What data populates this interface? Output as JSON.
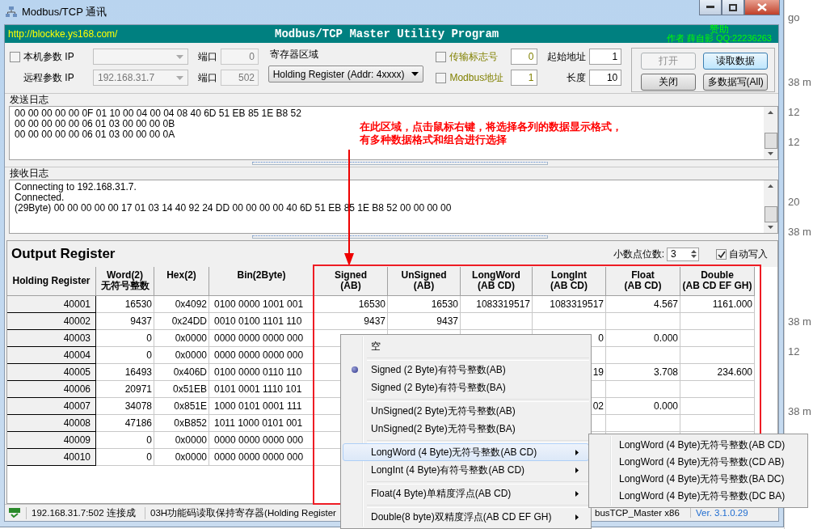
{
  "window": {
    "title": "Modbus/TCP 通讯"
  },
  "banner": {
    "link": "http://blockke.ys168.com/",
    "title": "Modbus/TCP Master Utility Program",
    "sponsor": "赞助",
    "author": "作者 薛自影 QQ:22236263"
  },
  "local": {
    "label": "本机参数 IP",
    "checked": false,
    "port_label": "端口",
    "port": "0"
  },
  "remote": {
    "label": "远程参数 IP",
    "ip": "192.168.31.7",
    "port_label": "端口",
    "port": "502"
  },
  "register_area": {
    "label": "寄存器区域",
    "value": "Holding Register (Addr: 4xxxx)"
  },
  "options": [
    {
      "label": "传输标志号",
      "checked": false,
      "value": "0"
    },
    {
      "label": "Modbus地址",
      "checked": false,
      "value": "1"
    }
  ],
  "address": [
    {
      "label": "起始地址",
      "value": "1"
    },
    {
      "label": "长度",
      "value": "10"
    }
  ],
  "buttons": [
    {
      "label": "打开",
      "disabled": true
    },
    {
      "label": "读取数据",
      "disabled": false
    },
    {
      "label": "关闭",
      "disabled": false
    },
    {
      "label": "多数据写(All)",
      "disabled": false
    }
  ],
  "send_log": {
    "title": "发送日志",
    "lines": [
      "00 00 00 00 00 0F 01 10 00 04 00 04 08 40 6D 51 EB 85 1E B8 52",
      "00 00 00 00 00 06 01 03 00 00 00 0B",
      "00 00 00 00 00 06 01 03 00 00 00 0A"
    ]
  },
  "recv_log": {
    "title": "接收日志",
    "lines": [
      "Connecting to 192.168.31.7.",
      "Connected.",
      "(29Byte) 00 00 00 00 00 17 01 03 14 40 92 24 DD 00 00 00 00 40 6D 51 EB 85 1E B8 52 00 00 00 00"
    ]
  },
  "annotation": {
    "lines": [
      "在此区域，点击鼠标右键，将选择各列的数据显示格式，",
      "有多种数据格式和组合进行选择"
    ]
  },
  "output": {
    "title": "Output Register",
    "decimals_label": "小数点位数:",
    "decimals": "3",
    "auto_write": {
      "label": "自动写入",
      "checked": true
    }
  },
  "table": {
    "columns": [
      "Holding Register",
      "Word(2)\n无符号整数",
      "Hex(2)",
      "Bin(2Byte)",
      "Signed\n(AB)",
      "UnSigned\n(AB)",
      "LongWord\n(AB CD)",
      "LongInt\n(AB CD)",
      "Float\n(AB CD)",
      "Double\n(AB CD EF GH)"
    ],
    "rows": [
      {
        "cells": [
          "40001",
          "16530",
          "0x4092",
          "0100 0000 1001 001",
          "16530",
          "16530",
          "1083319517",
          "1083319517",
          "4.567",
          "1161.000"
        ]
      },
      {
        "cells": [
          "40002",
          "9437",
          "0x24DD",
          "0010 0100 1101 110",
          "9437",
          "9437",
          null,
          null,
          null,
          null
        ]
      },
      {
        "cells": [
          "40003",
          "0",
          "0x0000",
          "0000 0000 0000 000",
          null,
          null,
          null,
          "0",
          "0.000",
          null
        ]
      },
      {
        "cells": [
          "40004",
          "0",
          "0x0000",
          "0000 0000 0000 000",
          null,
          null,
          null,
          null,
          null,
          null
        ]
      },
      {
        "cells": [
          "40005",
          "16493",
          "0x406D",
          "0100 0000 0110 110",
          null,
          null,
          null,
          "19",
          "3.708",
          "234.600"
        ]
      },
      {
        "cells": [
          "40006",
          "20971",
          "0x51EB",
          "0101 0001 1110 101",
          null,
          null,
          null,
          null,
          null,
          null
        ]
      },
      {
        "cells": [
          "40007",
          "34078",
          "0x851E",
          "1000 0101 0001 111",
          null,
          null,
          null,
          "02",
          "0.000",
          null
        ]
      },
      {
        "cells": [
          "40008",
          "47186",
          "0xB852",
          "1011 1000 0101 001",
          null,
          null,
          null,
          null,
          null,
          null
        ]
      },
      {
        "cells": [
          "40009",
          "0",
          "0x0000",
          "0000 0000 0000 000",
          null,
          null,
          null,
          null,
          null,
          null
        ]
      },
      {
        "cells": [
          "40010",
          "0",
          "0x0000",
          "0000 0000 0000 000",
          null,
          null,
          null,
          null,
          null,
          null
        ]
      }
    ]
  },
  "context_menu": {
    "groups": [
      [
        {
          "label": "空",
          "checked": false,
          "selected": false,
          "submenu": false
        }
      ],
      [
        {
          "label": "Signed (2 Byte)有符号整数(AB)",
          "checked": true,
          "selected": false,
          "submenu": false
        },
        {
          "label": "Signed (2 Byte)有符号整数(BA)",
          "checked": false,
          "selected": false,
          "submenu": false
        }
      ],
      [
        {
          "label": "UnSigned(2 Byte)无符号整数(AB)",
          "checked": false,
          "selected": false,
          "submenu": false
        },
        {
          "label": "UnSigned(2 Byte)无符号整数(BA)",
          "checked": false,
          "selected": false,
          "submenu": false
        }
      ],
      [
        {
          "label": "LongWord (4 Byte)无符号整数(AB CD)",
          "checked": false,
          "selected": true,
          "submenu": true
        },
        {
          "label": "LongInt (4 Byte)有符号整数(AB CD)",
          "checked": false,
          "selected": false,
          "submenu": true
        }
      ],
      [
        {
          "label": "Float(4 Byte)单精度浮点(AB CD)",
          "checked": false,
          "selected": false,
          "submenu": true
        }
      ],
      [
        {
          "label": "Double(8 byte)双精度浮点(AB CD EF GH)",
          "checked": false,
          "selected": false,
          "submenu": true
        }
      ]
    ]
  },
  "submenu": {
    "items": [
      {
        "label": "LongWord (4 Byte)无符号整数(AB CD)",
        "checked": false,
        "selected": false
      },
      {
        "label": "LongWord (4 Byte)无符号整数(CD AB)",
        "checked": false,
        "selected": false
      },
      {
        "label": "LongWord (4 Byte)无符号整数(BA DC)",
        "checked": false,
        "selected": false
      },
      {
        "label": "LongWord (4 Byte)无符号整数(DC BA)",
        "checked": false,
        "selected": false
      }
    ]
  },
  "status_bar": {
    "connection": "192.168.31.7:502 连接成",
    "message": "03H功能码读取保持寄存器(Holding Register",
    "app": "busTCP_Master x86",
    "version": "Ver. 3.1.0.29"
  },
  "background": {
    "top": "go",
    "rows": [
      "38 m",
      "12",
      "12",
      null,
      "20",
      "38 m",
      null,
      null,
      "38 m",
      "12",
      null,
      "38 m"
    ]
  }
}
